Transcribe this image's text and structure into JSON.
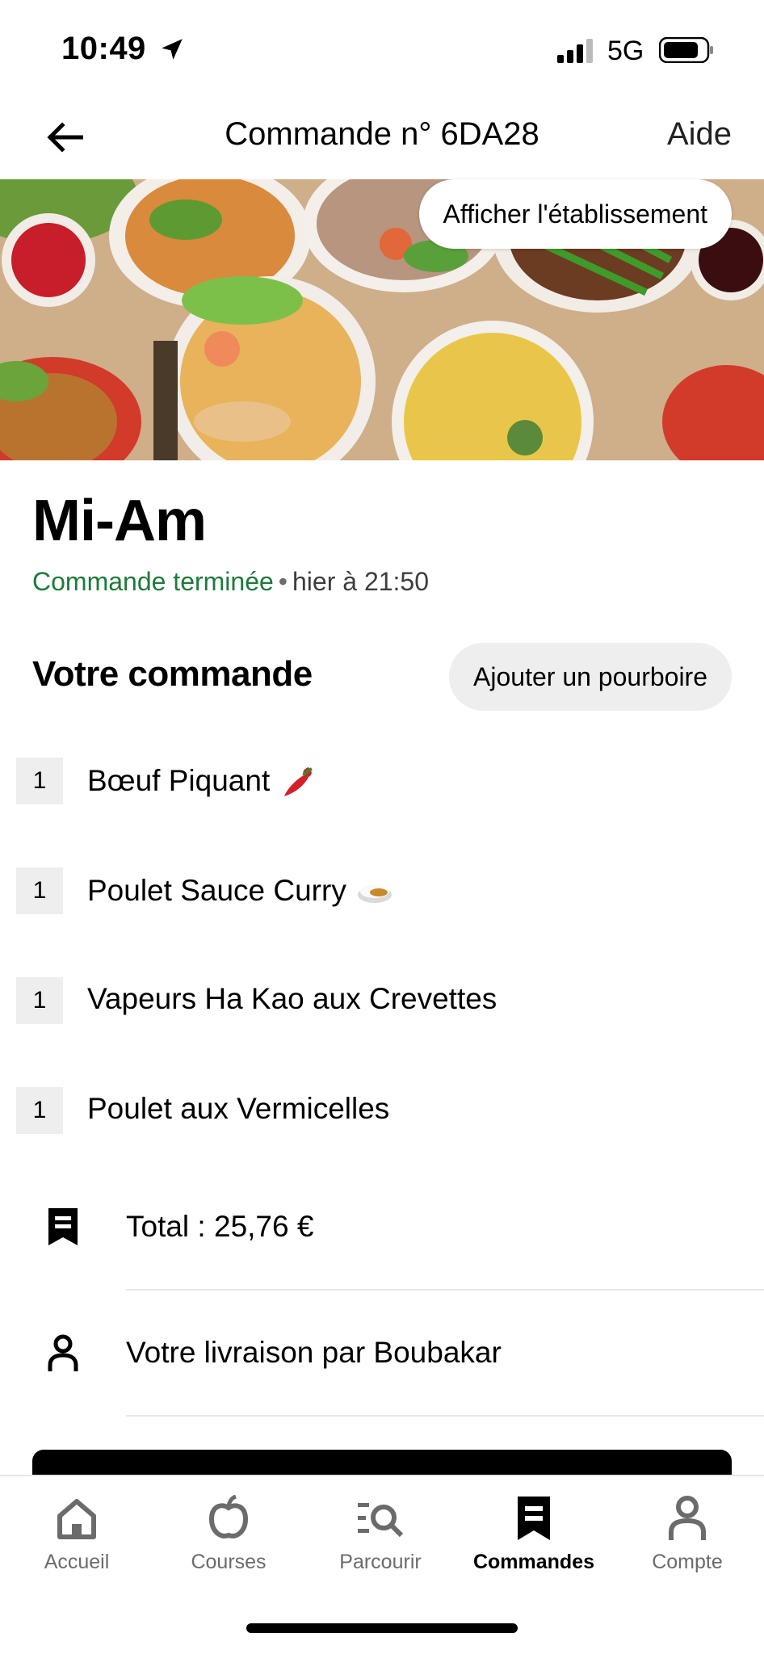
{
  "status_bar": {
    "time": "10:49",
    "network": "5G",
    "icons": [
      "location-arrow-icon",
      "cellular-signal-icon",
      "battery-icon"
    ]
  },
  "header": {
    "title": "Commande n° 6DA28",
    "help_label": "Aide",
    "back_icon": "back-arrow-icon"
  },
  "hero": {
    "view_store_label": "Afficher l'établissement"
  },
  "store": {
    "name": "Mi-Am",
    "status": "Commande terminée",
    "separator": "•",
    "time": "hier à 21:50"
  },
  "order": {
    "title": "Votre commande",
    "tip_label": "Ajouter un pourboire",
    "items": [
      {
        "qty": "1",
        "name": "Bœuf Piquant",
        "emoji": "chili-pepper"
      },
      {
        "qty": "1",
        "name": "Poulet Sauce Curry",
        "emoji": "curry-rice"
      },
      {
        "qty": "1",
        "name": "Vapeurs Ha Kao aux Crevettes",
        "emoji": ""
      },
      {
        "qty": "1",
        "name": "Poulet aux Vermicelles",
        "emoji": ""
      }
    ]
  },
  "summary": {
    "total_label": "Total : 25,76 €",
    "delivery_label": "Votre livraison par Boubakar"
  },
  "tab_bar": {
    "tabs": [
      {
        "label": "Accueil",
        "icon": "home-icon",
        "active": false
      },
      {
        "label": "Courses",
        "icon": "apple-icon",
        "active": false
      },
      {
        "label": "Parcourir",
        "icon": "browse-search-icon",
        "active": false
      },
      {
        "label": "Commandes",
        "icon": "receipt-icon",
        "active": true
      },
      {
        "label": "Compte",
        "icon": "account-icon",
        "active": false
      }
    ]
  },
  "colors": {
    "status_green": "#1e7a3b",
    "muted_text": "#6b6b6b",
    "chip_bg": "#eeeeee"
  }
}
